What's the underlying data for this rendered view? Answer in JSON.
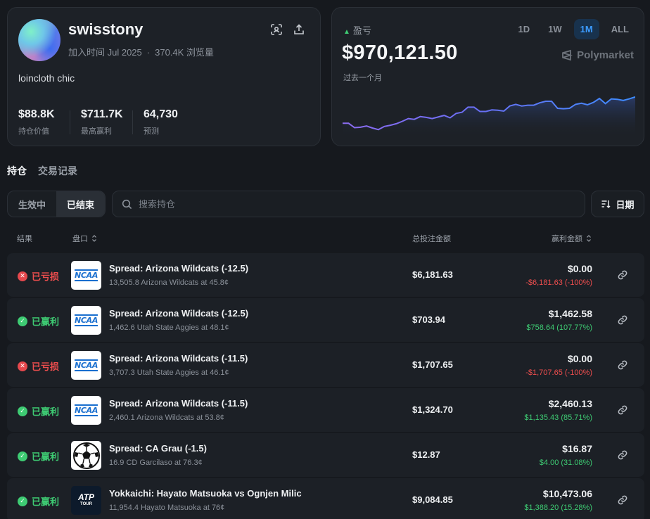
{
  "profile": {
    "username": "swisstony",
    "joined": "加入时间 Jul 2025",
    "views": "370.4K 浏览量",
    "bio": "loincloth chic",
    "stats": [
      {
        "value": "$88.8K",
        "label": "持仓价值"
      },
      {
        "value": "$711.7K",
        "label": "最高赢利"
      },
      {
        "value": "64,730",
        "label": "预测"
      }
    ]
  },
  "pnl": {
    "label": "盈亏",
    "value": "$970,121.50",
    "period": "过去一个月",
    "brand": "Polymarket",
    "ranges": [
      "1D",
      "1W",
      "1M",
      "ALL"
    ],
    "active_range": "1M"
  },
  "chart_data": {
    "type": "area",
    "x": [
      0,
      1,
      2,
      3,
      4,
      5,
      6,
      7,
      8,
      9,
      10,
      11,
      12,
      13,
      14,
      15,
      16,
      17,
      18,
      19,
      20,
      21,
      22,
      23,
      24,
      25,
      26,
      27,
      28,
      29,
      30,
      31,
      32,
      33,
      34,
      35,
      36,
      37,
      38,
      39,
      40,
      41,
      42,
      43,
      44,
      45,
      46,
      47,
      48,
      49
    ],
    "values": [
      0.28,
      0.28,
      0.17,
      0.18,
      0.21,
      0.16,
      0.12,
      0.2,
      0.23,
      0.27,
      0.33,
      0.4,
      0.38,
      0.45,
      0.43,
      0.4,
      0.44,
      0.48,
      0.42,
      0.53,
      0.56,
      0.69,
      0.69,
      0.58,
      0.58,
      0.62,
      0.61,
      0.59,
      0.72,
      0.76,
      0.72,
      0.74,
      0.74,
      0.8,
      0.84,
      0.84,
      0.66,
      0.65,
      0.66,
      0.76,
      0.79,
      0.75,
      0.81,
      0.91,
      0.78,
      0.9,
      0.89,
      0.86,
      0.9,
      0.95
    ],
    "color": "#5b7dff",
    "fill_top": "#2b3d6d",
    "grid": false
  },
  "tabs": [
    "持仓",
    "交易记录"
  ],
  "filters": {
    "segments": [
      "生效中",
      "已结束"
    ],
    "active": "已结束"
  },
  "search": {
    "placeholder": "搜索持仓"
  },
  "sort": {
    "label": "日期"
  },
  "table": {
    "headers": {
      "result": "结果",
      "market": "盘口",
      "total": "总投注金额",
      "payout": "赢利金额"
    },
    "rows": [
      {
        "result": "已亏损",
        "status": "lost",
        "logo": "NCAA",
        "title": "Spread: Arizona Wildcats (-12.5)",
        "sub": "13,505.8 Arizona Wildcats at 45.8¢",
        "bet": "$6,181.63",
        "payout": "$0.00",
        "change": "-$6,181.63 (-100%)",
        "dir": "neg"
      },
      {
        "result": "已赢利",
        "status": "won",
        "logo": "NCAA",
        "title": "Spread: Arizona Wildcats (-12.5)",
        "sub": "1,462.6 Utah State Aggies at 48.1¢",
        "bet": "$703.94",
        "payout": "$1,462.58",
        "change": "$758.64 (107.77%)",
        "dir": "pos"
      },
      {
        "result": "已亏损",
        "status": "lost",
        "logo": "NCAA",
        "title": "Spread: Arizona Wildcats (-11.5)",
        "sub": "3,707.3 Utah State Aggies at 46.1¢",
        "bet": "$1,707.65",
        "payout": "$0.00",
        "change": "-$1,707.65 (-100%)",
        "dir": "neg"
      },
      {
        "result": "已赢利",
        "status": "won",
        "logo": "NCAA",
        "title": "Spread: Arizona Wildcats (-11.5)",
        "sub": "2,460.1 Arizona Wildcats at 53.8¢",
        "bet": "$1,324.70",
        "payout": "$2,460.13",
        "change": "$1,135.43 (85.71%)",
        "dir": "pos"
      },
      {
        "result": "已赢利",
        "status": "won",
        "logo": "soccer",
        "title": "Spread: CA Grau (-1.5)",
        "sub": "16.9 CD Garcilaso at 76.3¢",
        "bet": "$12.87",
        "payout": "$16.87",
        "change": "$4.00 (31.08%)",
        "dir": "pos"
      },
      {
        "result": "已赢利",
        "status": "won",
        "logo": "ATP",
        "title": "Yokkaichi: Hayato Matsuoka vs Ognjen Milic",
        "sub": "11,954.4 Hayato Matsuoka at 76¢",
        "bet": "$9,084.85",
        "payout": "$10,473.06",
        "change": "$1,388.20 (15.28%)",
        "dir": "pos"
      }
    ]
  },
  "atp_sub": "TOUR"
}
